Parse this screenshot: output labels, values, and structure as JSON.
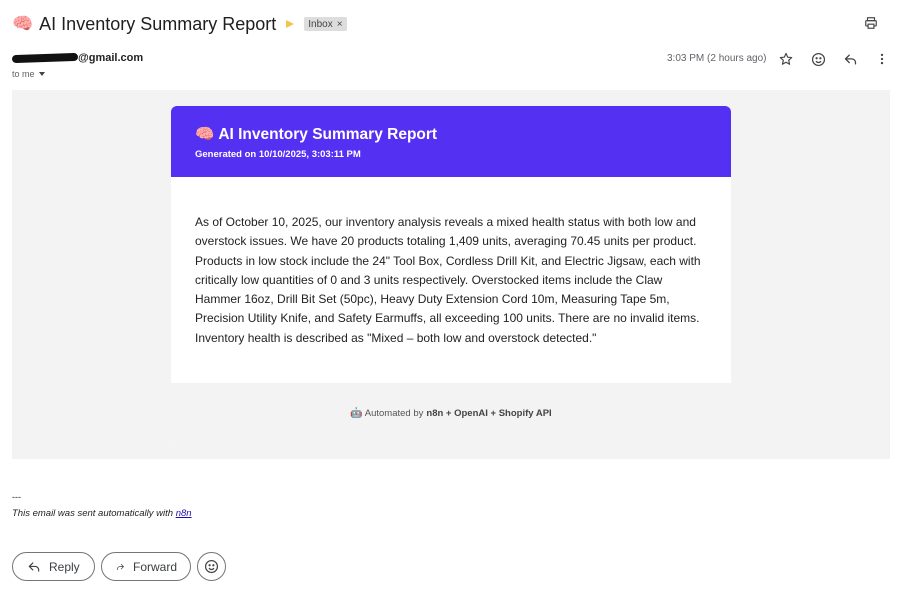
{
  "subject": {
    "emoji": "🧠",
    "title": "AI Inventory Summary Report",
    "label": "Inbox",
    "label_remove": "×"
  },
  "sender": {
    "email_suffix": "@gmail.com",
    "to": "to me",
    "timestamp": "3:03 PM (2 hours ago)"
  },
  "card": {
    "emoji": "🧠",
    "title": "AI Inventory Summary Report",
    "subtitle": "Generated on 10/10/2025, 3:03:11 PM",
    "body": "As of October 10, 2025, our inventory analysis reveals a mixed health status with both low and overstock issues. We have 20 products totaling 1,409 units, averaging 70.45 units per product. Products in low stock include the 24\" Tool Box, Cordless Drill Kit, and Electric Jigsaw, each with critically low quantities of 0 and 3 units respectively. Overstocked items include the Claw Hammer 16oz, Drill Bit Set (50pc), Heavy Duty Extension Cord 10m, Measuring Tape 5m, Precision Utility Knife, and Safety Earmuffs, all exceeding 100 units. There are no invalid items. Inventory health is described as \"Mixed – both low and overstock detected.\"",
    "footer_emoji": "🤖",
    "footer_prefix": "Automated by",
    "footer_bold": "n8n + OpenAI + Shopify API"
  },
  "signature": {
    "dash": "---",
    "text": "This email was sent automatically with",
    "link": "n8n"
  },
  "actions": {
    "reply": "Reply",
    "forward": "Forward"
  },
  "colors": {
    "header_bg": "#5430f2",
    "email_area_bg": "#f3f3f4",
    "label_chip_bg": "#dddddd",
    "importance": "#f3c44a"
  },
  "icons": [
    "print-icon",
    "star-icon",
    "emoji-icon",
    "reply-icon",
    "more-vert-icon",
    "forward-icon",
    "importance-marker-icon"
  ]
}
